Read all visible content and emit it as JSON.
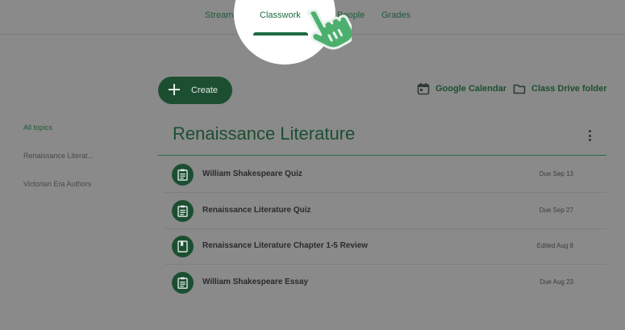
{
  "nav": {
    "tabs": [
      "Stream",
      "Classwork",
      "People",
      "Grades"
    ],
    "active": "Classwork"
  },
  "toolbar": {
    "create_label": "Create",
    "calendar_label": "Google Calendar",
    "drive_label": "Class Drive folder"
  },
  "sidebar": {
    "items": [
      "All topics",
      "Renaissance Literat...",
      "Victorian Era Authors"
    ]
  },
  "topic": {
    "title": "Renaissance Literature"
  },
  "assignments": [
    {
      "title": "William Shakespeare Quiz",
      "meta": "Due Sep 13",
      "icon": "assignment-icon"
    },
    {
      "title": "Renaissance Literature Quiz",
      "meta": "Due Sep 27",
      "icon": "assignment-icon"
    },
    {
      "title": "Renaissance Literature Chapter 1-5 Review",
      "meta": "Edited Aug 8",
      "icon": "material-icon"
    },
    {
      "title": "William Shakespeare Essay",
      "meta": "Due Aug 23",
      "icon": "assignment-icon"
    }
  ],
  "colors": {
    "accent": "#1c4f31",
    "overlay_bg": "#8a8a8a",
    "cursor": "#4caf6e"
  }
}
